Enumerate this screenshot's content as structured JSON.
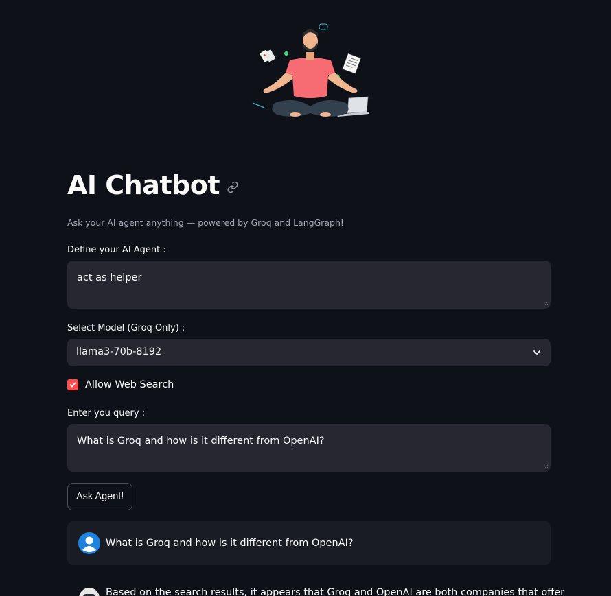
{
  "app": {
    "title": "AI Chatbot",
    "subtitle": "Ask your AI agent anything — powered by Groq and LangGraph!"
  },
  "agent": {
    "label": "Define your AI Agent :",
    "value": "act as helper"
  },
  "model": {
    "label": "Select Model (Groq Only) :",
    "selected": "llama3-70b-8192"
  },
  "web_search": {
    "label": "Allow Web Search",
    "checked": true
  },
  "query": {
    "label": "Enter you query :",
    "value": "What is Groq and how is it different from OpenAI?"
  },
  "ask_button": {
    "label": "Ask Agent!"
  },
  "chat": {
    "messages": [
      {
        "role": "user",
        "text": "What is Groq and how is it different from OpenAI?"
      },
      {
        "role": "assistant",
        "text": "Based on the search results, it appears that Groq and OpenAI are both companies that offer"
      }
    ]
  },
  "colors": {
    "background": "#0e1117",
    "input_bg": "#262730",
    "accent": "#ff4b4b",
    "user_avatar": "#1c83e1"
  },
  "icons": {
    "hero": "meditating-person-illustration",
    "title_link": "link-icon",
    "select": "chevron-down-icon",
    "checkbox": "checkmark-icon",
    "user_avatar": "user-avatar-icon",
    "assistant_avatar": "robot-avatar-icon"
  }
}
